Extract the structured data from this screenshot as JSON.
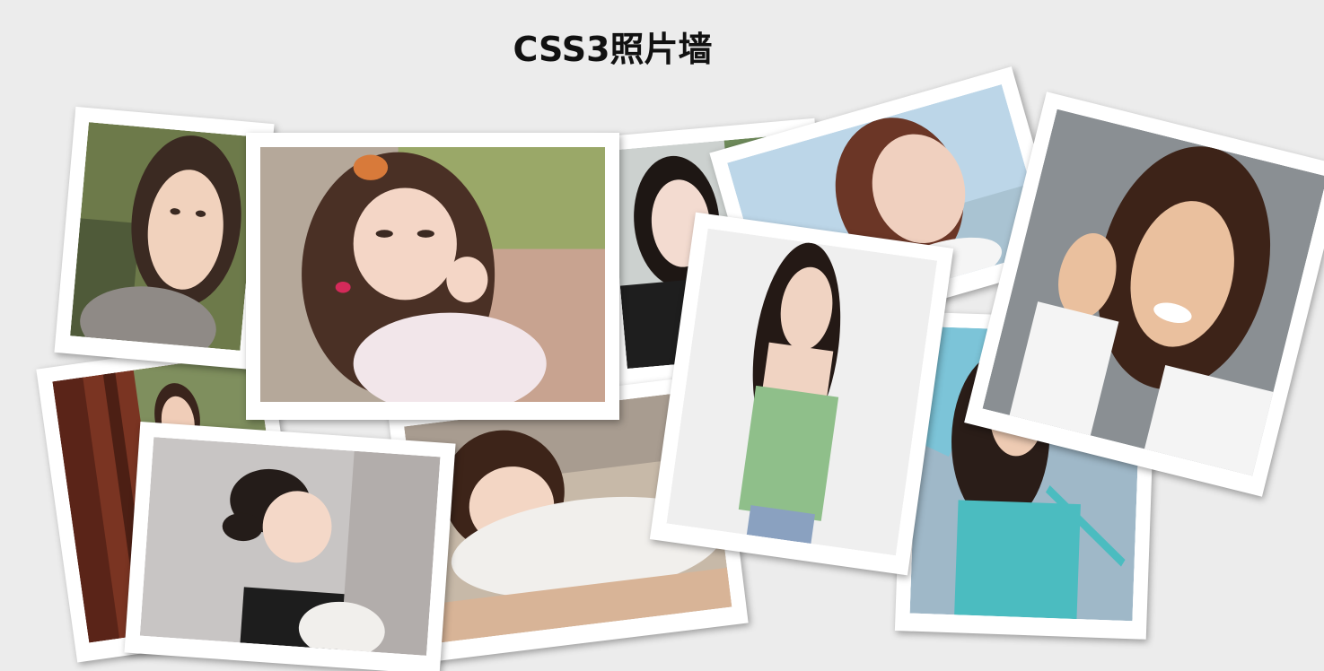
{
  "page": {
    "title": "CSS3照片墙"
  },
  "photos": [
    {
      "alt": "girl-hand-on-chin",
      "bg": "#6d7a4a",
      "skin": "#f1d2bd",
      "hair": "#3b2a22",
      "cloth": "#8f8a86"
    },
    {
      "alt": "girl-pigtail-smile",
      "bg": "#a7b38a",
      "skin": "#f4d6c6",
      "hair": "#4a3025",
      "cloth": "#f2e6ea"
    },
    {
      "alt": "girl-black-sweater",
      "bg": "#ccd1cf",
      "skin": "#f3dbd0",
      "hair": "#1e1714",
      "cloth": "#1e1e1e"
    },
    {
      "alt": "girl-seaside-profile",
      "bg": "#bcd6e8",
      "skin": "#f0d0bf",
      "hair": "#6b3626",
      "cloth": "#f5f5f5"
    },
    {
      "alt": "girl-green-camisole",
      "bg": "#efefef",
      "skin": "#f0d3c2",
      "hair": "#241915",
      "cloth": "#8fbf8a"
    },
    {
      "alt": "girl-hand-in-hair",
      "bg": "#8a8f93",
      "skin": "#eac09e",
      "hair": "#3d2318",
      "cloth": "#f4f4f4"
    },
    {
      "alt": "girl-window-frame",
      "bg": "#7a3422",
      "skin": "#f0cdb8",
      "hair": "#3a241c",
      "cloth": "#a24a2c"
    },
    {
      "alt": "woman-bun-smile",
      "bg": "#c8c5c4",
      "skin": "#f4d8c8",
      "hair": "#241c19",
      "cloth": "#1d1d1d"
    },
    {
      "alt": "girl-white-scarf",
      "bg": "#c7b9a8",
      "skin": "#f3d6c4",
      "hair": "#3d2419",
      "cloth": "#f1efec"
    },
    {
      "alt": "girl-umbrella-teal",
      "bg": "#9fb8c8",
      "skin": "#eecbb3",
      "hair": "#2a1d18",
      "cloth": "#4bbcc0"
    }
  ]
}
